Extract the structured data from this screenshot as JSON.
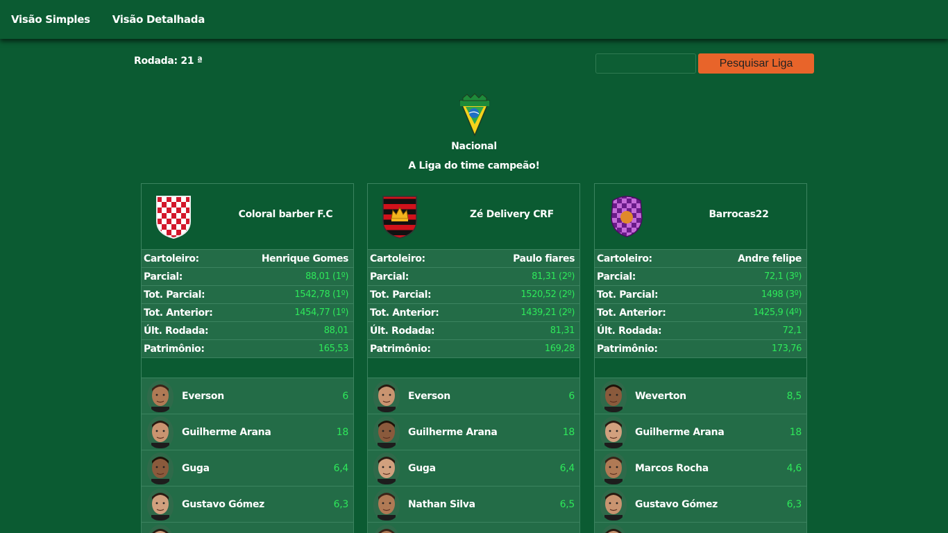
{
  "nav": {
    "simple": "Visão Simples",
    "detailed": "Visão Detalhada"
  },
  "round": {
    "label": "Rodada: 21 ª"
  },
  "search": {
    "placeholder": "",
    "button": "Pesquisar Liga"
  },
  "league": {
    "name": "Nacional",
    "slogan": "A Liga do time campeão!"
  },
  "labels": {
    "owner": "Cartoleiro:",
    "partial": "Parcial:",
    "total_partial": "Tot. Parcial:",
    "total_previous": "Tot. Anterior:",
    "last_round": "Últ. Rodada:",
    "assets": "Patrimônio:"
  },
  "teams": [
    {
      "name": "Coloral barber F.C",
      "shield": "checkered-shield",
      "owner": "Henrique Gomes",
      "partial": "88,01 (1º)",
      "total_partial": "1542,78 (1º)",
      "total_previous": "1454,77 (1º)",
      "last_round": "88,01",
      "assets": "165,53",
      "players": [
        {
          "name": "Everson",
          "score": "6"
        },
        {
          "name": "Guilherme Arana",
          "score": "18"
        },
        {
          "name": "Guga",
          "score": "6,4"
        },
        {
          "name": "Gustavo Gómez",
          "score": "6,3"
        }
      ]
    },
    {
      "name": "Zé Delivery CRF",
      "shield": "striped-crown-shield",
      "owner": "Paulo fiares",
      "partial": "81,31 (2º)",
      "total_partial": "1520,52 (2º)",
      "total_previous": "1439,21 (2º)",
      "last_round": "81,31",
      "assets": "169,28",
      "players": [
        {
          "name": "Everson",
          "score": "6"
        },
        {
          "name": "Guilherme Arana",
          "score": "18"
        },
        {
          "name": "Guga",
          "score": "6,4"
        },
        {
          "name": "Nathan Silva",
          "score": "6,5"
        }
      ]
    },
    {
      "name": "Barrocas22",
      "shield": "purple-checkered-shield",
      "owner": "Andre felipe",
      "partial": "72,1 (3º)",
      "total_partial": "1498 (3º)",
      "total_previous": "1425,9 (4º)",
      "last_round": "72,1",
      "assets": "173,76",
      "players": [
        {
          "name": "Weverton",
          "score": "8,5"
        },
        {
          "name": "Guilherme Arana",
          "score": "18"
        },
        {
          "name": "Marcos Rocha",
          "score": "4,6"
        },
        {
          "name": "Gustavo Gómez",
          "score": "6,3"
        }
      ]
    }
  ],
  "colors": {
    "background": "#0b5b32",
    "row": "#236c47",
    "accent": "#e8642a",
    "score": "#2ee85a"
  }
}
